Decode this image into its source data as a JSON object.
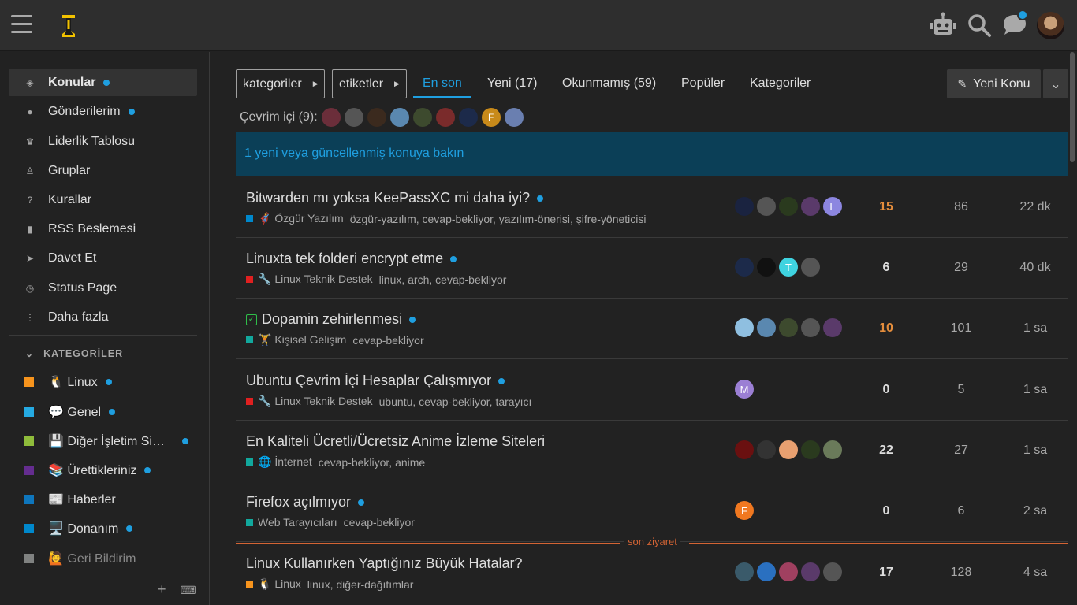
{
  "header": {
    "icons": [
      "menu-icon",
      "site-logo",
      "robot-icon",
      "search-icon",
      "chat-icon",
      "user-avatar"
    ]
  },
  "sidebar": {
    "items": [
      {
        "label": "Konular",
        "icon": "layers-icon",
        "dot": true
      },
      {
        "label": "Gönderilerim",
        "icon": "user-icon",
        "dot": true
      },
      {
        "label": "Liderlik Tablosu",
        "icon": "crown-icon",
        "dot": false
      },
      {
        "label": "Gruplar",
        "icon": "users-icon",
        "dot": false
      },
      {
        "label": "Kurallar",
        "icon": "question-icon",
        "dot": false
      },
      {
        "label": "RSS Beslemesi",
        "icon": "bookmark-icon",
        "dot": false
      },
      {
        "label": "Davet Et",
        "icon": "paper-plane-icon",
        "dot": false
      },
      {
        "label": "Status Page",
        "icon": "clock-icon",
        "dot": false
      },
      {
        "label": "Daha fazla",
        "icon": "ellipsis-icon",
        "dot": false
      }
    ],
    "categories_header": "KATEGORİLER",
    "categories": [
      {
        "label": "🐧 Linux",
        "color": "#f7941d",
        "dot": true
      },
      {
        "label": "💬 Genel",
        "color": "#25aae2",
        "dot": true
      },
      {
        "label": "💾 Diğer İşletim Si…",
        "color": "#8fbc3b",
        "dot": true
      },
      {
        "label": "📚 Ürettikleriniz",
        "color": "#652d90",
        "dot": true
      },
      {
        "label": "📰 Haberler",
        "color": "#0e76bd",
        "dot": false
      },
      {
        "label": "🖥️ Donanım",
        "color": "#0088cc",
        "dot": true
      },
      {
        "label": "🙋 Geri Bildirim",
        "color": "#808281",
        "dot": false
      }
    ]
  },
  "nav": {
    "categories_btn": "kategoriler",
    "tags_btn": "etiketler",
    "tabs": [
      "En son",
      "Yeni (17)",
      "Okunmamış (59)",
      "Popüler",
      "Kategoriler"
    ],
    "new_topic": "Yeni Konu"
  },
  "online": {
    "label": "Çevrim içi (9):",
    "avatars": [
      {
        "color": "#6b2e3a",
        "letter": ""
      },
      {
        "color": "#555555",
        "letter": ""
      },
      {
        "color": "#3b2a1e",
        "letter": ""
      },
      {
        "color": "#5a88b0",
        "letter": ""
      },
      {
        "color": "#3d4a2e",
        "letter": ""
      },
      {
        "color": "#7a2b2b",
        "letter": ""
      },
      {
        "color": "#1c2a4a",
        "letter": ""
      },
      {
        "color": "#c88a1a",
        "letter": "F"
      },
      {
        "color": "#6a7fb0",
        "letter": ""
      }
    ]
  },
  "banner": "1 yeni veya güncellenmiş konuya bakın",
  "topics": [
    {
      "title": "Bitwarden mı yoksa KeePassXC mi daha iyi?",
      "unread": true,
      "solved": false,
      "category": "🦸 Özgür Yazılım",
      "cat_color": "#0088cc",
      "tags": "özgür-yazılım, cevap-bekliyor, yazılım-önerisi, şifre-yöneticisi",
      "posters": [
        {
          "c": "#1a2340",
          "l": ""
        },
        {
          "c": "#555",
          "l": ""
        },
        {
          "c": "#2a3a1e",
          "l": ""
        },
        {
          "c": "#5a3a6a",
          "l": ""
        },
        {
          "c": "#8c86e0",
          "l": "L"
        }
      ],
      "replies": "15",
      "hot": true,
      "views": "86",
      "activity": "22 dk"
    },
    {
      "title": "Linuxta tek folderi encrypt etme",
      "unread": true,
      "solved": false,
      "category": "🔧 Linux Teknik Destek",
      "cat_color": "#e02020",
      "tags": "linux, arch, cevap-bekliyor",
      "posters": [
        {
          "c": "#1c2a4a",
          "l": ""
        },
        {
          "c": "#111",
          "l": ""
        },
        {
          "c": "#3fd3e0",
          "l": "T"
        },
        {
          "c": "#555",
          "l": ""
        }
      ],
      "replies": "6",
      "hot": false,
      "views": "29",
      "activity": "40 dk"
    },
    {
      "title": "Dopamin zehirlenmesi",
      "unread": true,
      "solved": true,
      "category": "🏋️ Kişisel Gelişim",
      "cat_color": "#12a89d",
      "tags": "cevap-bekliyor",
      "posters": [
        {
          "c": "#8fbfe0",
          "l": ""
        },
        {
          "c": "#5a88b0",
          "l": ""
        },
        {
          "c": "#3d4a2e",
          "l": ""
        },
        {
          "c": "#555",
          "l": ""
        },
        {
          "c": "#5a3a6a",
          "l": ""
        }
      ],
      "replies": "10",
      "hot": true,
      "views": "101",
      "activity": "1 sa"
    },
    {
      "title": "Ubuntu Çevrim İçi Hesaplar Çalışmıyor",
      "unread": true,
      "solved": false,
      "category": "🔧 Linux Teknik Destek",
      "cat_color": "#e02020",
      "tags": "ubuntu, cevap-bekliyor, tarayıcı",
      "posters": [
        {
          "c": "#9b7fd4",
          "l": "M"
        }
      ],
      "replies": "0",
      "hot": false,
      "views": "5",
      "activity": "1 sa"
    },
    {
      "title": "En Kaliteli Ücretli/Ücretsiz Anime İzleme Siteleri",
      "unread": false,
      "solved": false,
      "category": "🌐 İnternet",
      "cat_color": "#12a89d",
      "tags": "cevap-bekliyor, anime",
      "posters": [
        {
          "c": "#6a1010",
          "l": ""
        },
        {
          "c": "#333",
          "l": ""
        },
        {
          "c": "#e8a070",
          "l": ""
        },
        {
          "c": "#2a3a1e",
          "l": ""
        },
        {
          "c": "#6a7a5a",
          "l": ""
        }
      ],
      "replies": "22",
      "hot": false,
      "views": "27",
      "activity": "1 sa"
    },
    {
      "title": "Firefox açılmıyor",
      "unread": true,
      "solved": false,
      "category": "Web Tarayıcıları",
      "cat_color": "#12a89d",
      "tags": "cevap-bekliyor",
      "posters": [
        {
          "c": "#f07820",
          "l": "F"
        }
      ],
      "replies": "0",
      "hot": false,
      "views": "6",
      "activity": "2 sa"
    },
    {
      "title": "Linux Kullanırken Yaptığınız Büyük Hatalar?",
      "unread": false,
      "solved": false,
      "category": "🐧 Linux",
      "cat_color": "#f7941d",
      "tags": "linux, diğer-dağıtımlar",
      "posters": [
        {
          "c": "#3a5a6a",
          "l": ""
        },
        {
          "c": "#2a70c0",
          "l": ""
        },
        {
          "c": "#a04060",
          "l": ""
        },
        {
          "c": "#5a3a6a",
          "l": ""
        },
        {
          "c": "#555",
          "l": ""
        }
      ],
      "replies": "17",
      "hot": false,
      "views": "128",
      "activity": "4 sa"
    }
  ],
  "last_visit_label": "son ziyaret",
  "colors": {
    "accent": "#1f9fe0",
    "hot": "#e48d3c",
    "last_visit": "#d46434",
    "banner_bg": "#0b3f57"
  }
}
